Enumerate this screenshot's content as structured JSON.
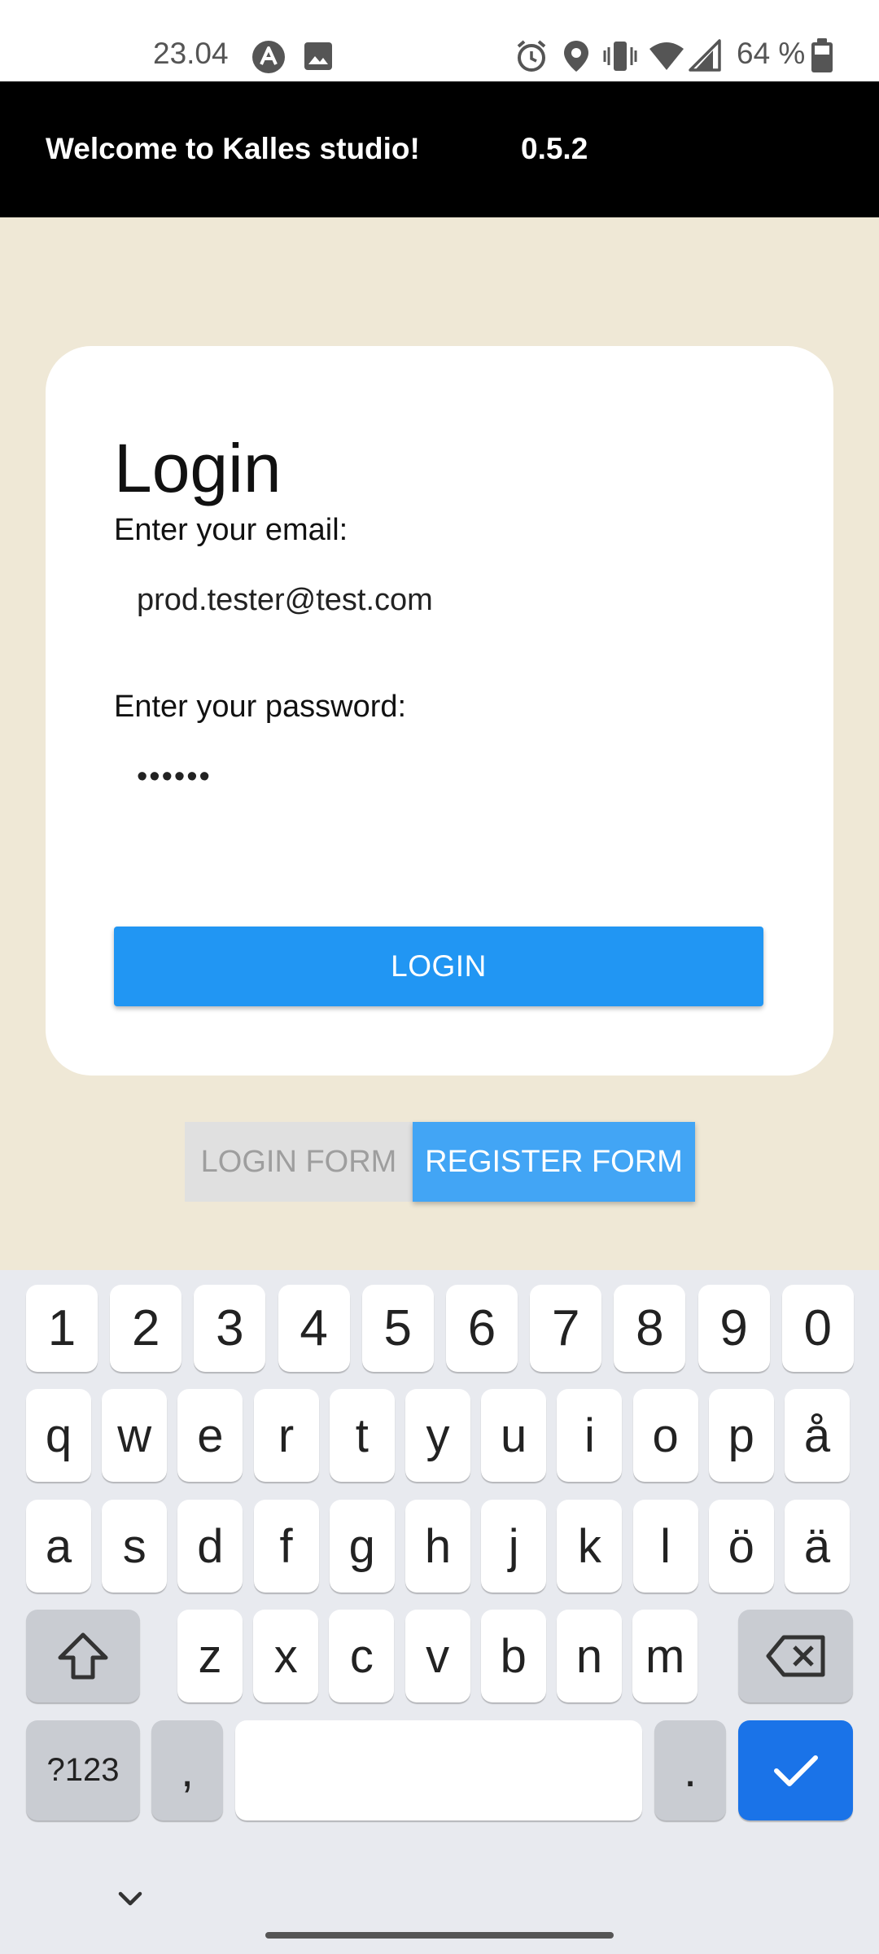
{
  "status_bar": {
    "time": "23.04",
    "battery_text": "64 %",
    "icons": [
      "app-a-icon",
      "image-icon",
      "alarm-icon",
      "location-icon",
      "vibrate-icon",
      "wifi-icon",
      "signal-icon",
      "battery-icon"
    ]
  },
  "app_bar": {
    "title": "Welcome to Kalles studio!",
    "version": "0.5.2"
  },
  "login_card": {
    "title": "Login",
    "email_label": "Enter your email:",
    "email_value": "prod.tester@test.com",
    "password_label": "Enter your password:",
    "password_value": "••••••",
    "login_button": "LOGIN"
  },
  "form_toggle": {
    "login_form": "LOGIN FORM",
    "register_form": "REGISTER FORM"
  },
  "keyboard": {
    "number_row": [
      "1",
      "2",
      "3",
      "4",
      "5",
      "6",
      "7",
      "8",
      "9",
      "0"
    ],
    "row1": [
      "q",
      "w",
      "e",
      "r",
      "t",
      "y",
      "u",
      "i",
      "o",
      "p",
      "å"
    ],
    "row2": [
      "a",
      "s",
      "d",
      "f",
      "g",
      "h",
      "j",
      "k",
      "l",
      "ö",
      "ä"
    ],
    "row3": [
      "z",
      "x",
      "c",
      "v",
      "b",
      "n",
      "m"
    ],
    "symbols_key": "?123",
    "comma_key": ",",
    "period_key": ".",
    "shift_icon": "shift-icon",
    "backspace_icon": "backspace-icon",
    "enter_icon": "check-icon",
    "hide_icon": "chevron-down-icon"
  },
  "colors": {
    "app_bar": "#000000",
    "background": "#efe8d6",
    "primary": "#2196f3",
    "register_active": "#42a5f5",
    "keyboard_enter": "#1a73e8"
  }
}
